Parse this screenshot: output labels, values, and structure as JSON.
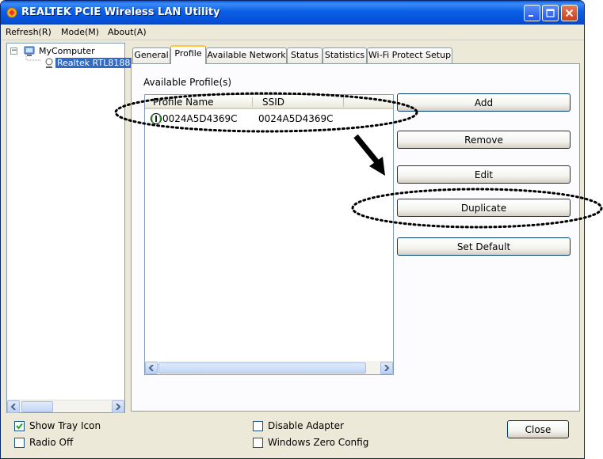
{
  "window": {
    "title": "REALTEK PCIE Wireless LAN Utility"
  },
  "menu": {
    "items": [
      {
        "label": "Refresh(R)"
      },
      {
        "label": "Mode(M)"
      },
      {
        "label": "About(A)"
      }
    ]
  },
  "tree": {
    "root": "MyComputer",
    "toggle": "−",
    "child": "Realtek RTL8188"
  },
  "tabs": [
    {
      "label": "General"
    },
    {
      "label": "Profile",
      "active": true
    },
    {
      "label": "Available Network"
    },
    {
      "label": "Status"
    },
    {
      "label": "Statistics"
    },
    {
      "label": "Wi-Fi Protect Setup"
    }
  ],
  "profile": {
    "group_label": "Available Profile(s)",
    "columns": [
      "Profile Name",
      "SSID"
    ],
    "rows": [
      {
        "name": "0024A5D4369C",
        "ssid": "0024A5D4369C"
      }
    ]
  },
  "buttons": {
    "add": "Add",
    "remove": "Remove",
    "edit": "Edit",
    "duplicate": "Duplicate",
    "set_default": "Set Default",
    "close": "Close"
  },
  "options": {
    "show_tray_icon": {
      "label": "Show Tray Icon",
      "checked": true
    },
    "radio_off": {
      "label": "Radio Off",
      "checked": false
    },
    "disable_adapter": {
      "label": "Disable Adapter",
      "checked": false
    },
    "windows_zero_config": {
      "label": "Windows Zero Config",
      "checked": false
    }
  },
  "colors": {
    "title_bar": "#0a5fe5",
    "dialog_bg": "#ece9d8",
    "selection": "#316ac5",
    "tab_highlight": "#ffc83c"
  }
}
